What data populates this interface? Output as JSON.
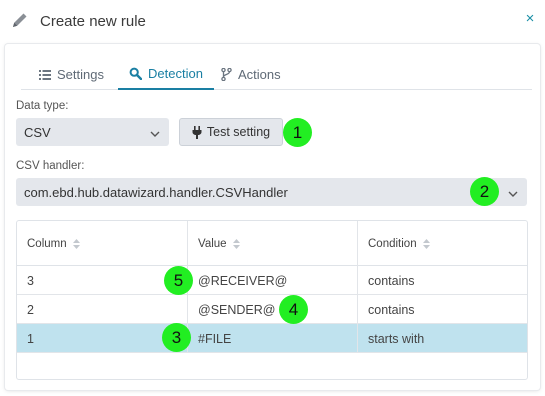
{
  "dialog": {
    "title": "Create new rule",
    "close_glyph": "×"
  },
  "tabs": [
    {
      "label": "Settings",
      "icon": "list-icon"
    },
    {
      "label": "Detection",
      "icon": "search-icon",
      "active": true
    },
    {
      "label": "Actions",
      "icon": "branch-icon"
    }
  ],
  "form": {
    "data_type_label": "Data type:",
    "data_type_value": "CSV",
    "test_button_label": "Test setting",
    "csv_handler_label": "CSV handler:",
    "csv_handler_value": "com.ebd.hub.datawizard.handler.CSVHandler"
  },
  "table": {
    "columns": [
      "Column",
      "Value",
      "Condition"
    ],
    "rows": [
      {
        "column": "3",
        "value": "@RECEIVER@",
        "condition": "contains",
        "selected": false
      },
      {
        "column": "2",
        "value": "@SENDER@",
        "condition": "contains",
        "selected": false
      },
      {
        "column": "1",
        "value": "#FILE",
        "condition": "starts with",
        "selected": true
      }
    ]
  },
  "markers": [
    "1",
    "2",
    "3",
    "4",
    "5"
  ],
  "colors": {
    "accent": "#1a7fa3",
    "selected_row": "#bfe2ee",
    "marker": "#22ee22",
    "control_bg": "#e4e7ec"
  }
}
